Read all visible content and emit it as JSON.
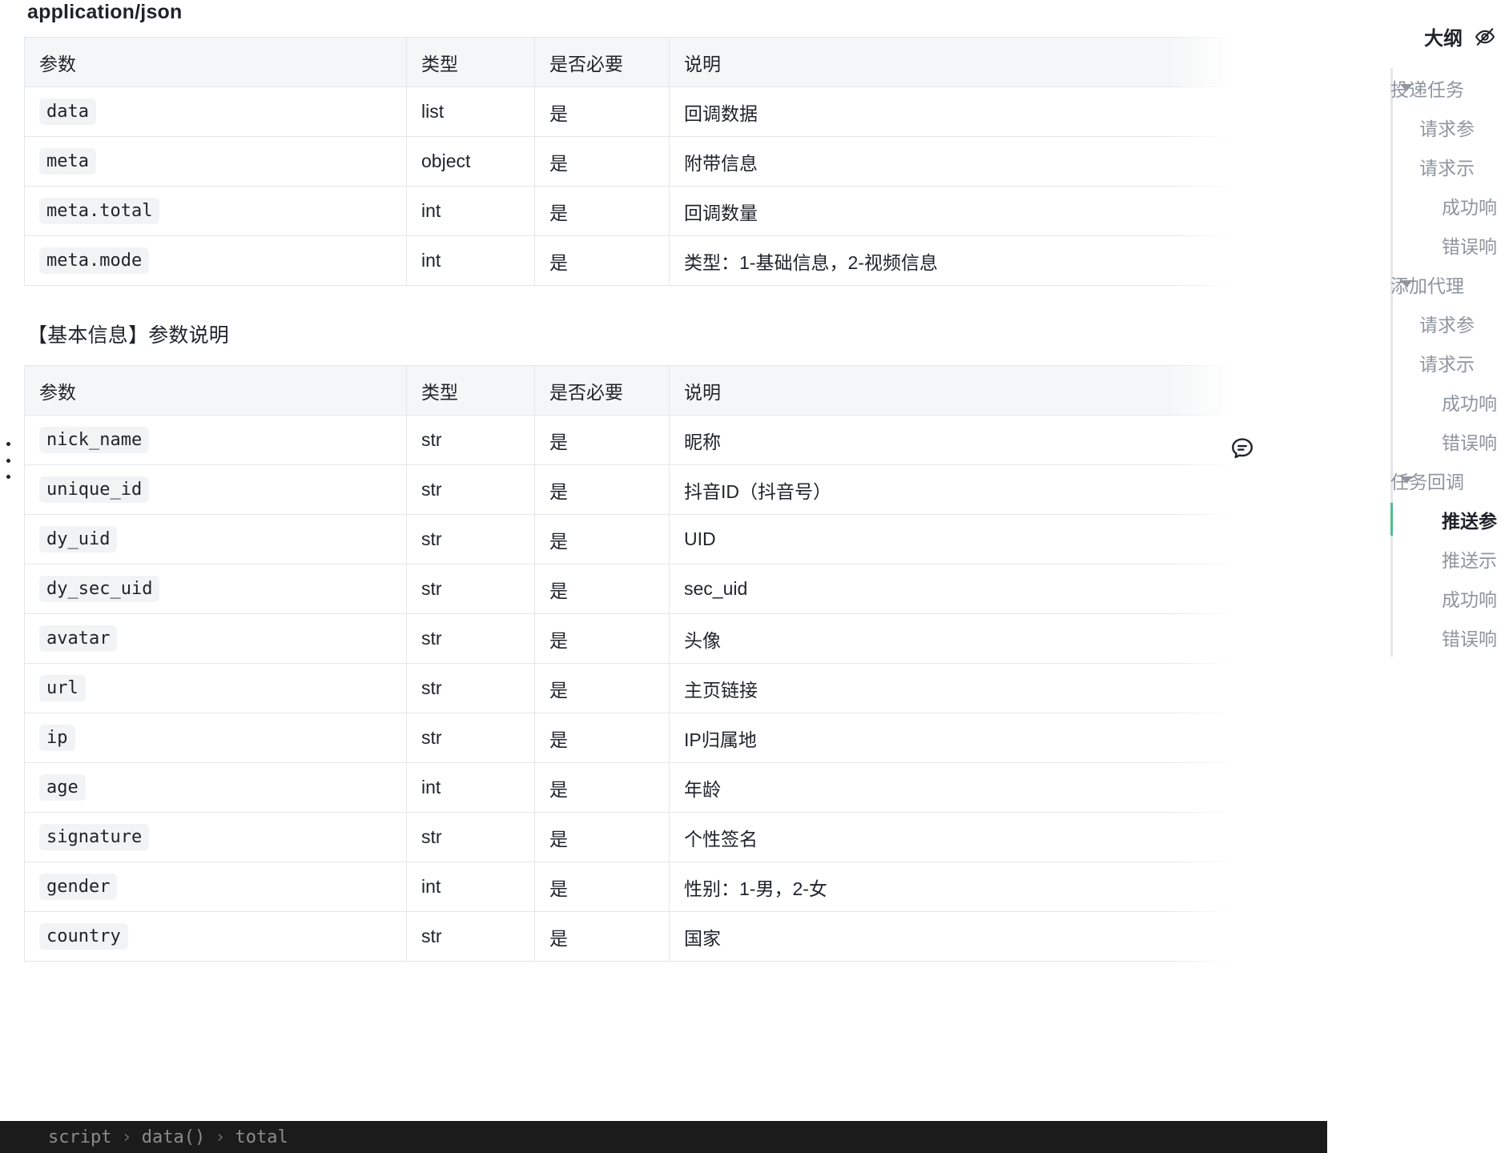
{
  "document": {
    "content_type_heading": "application/json",
    "basic_info_heading": "【基本信息】参数说明"
  },
  "table_columns": [
    "参数",
    "类型",
    "是否必要",
    "说明"
  ],
  "callback_table": {
    "rows": [
      {
        "param": "data",
        "type": "list",
        "required": "是",
        "desc": "回调数据"
      },
      {
        "param": "meta",
        "type": "object",
        "required": "是",
        "desc": "附带信息"
      },
      {
        "param": "meta.total",
        "type": "int",
        "required": "是",
        "desc": "回调数量"
      },
      {
        "param": "meta.mode",
        "type": "int",
        "required": "是",
        "desc": "类型：1-基础信息，2-视频信息"
      }
    ]
  },
  "basic_info_table": {
    "rows": [
      {
        "param": "nick_name",
        "type": "str",
        "required": "是",
        "desc": "昵称"
      },
      {
        "param": "unique_id",
        "type": "str",
        "required": "是",
        "desc": "抖音ID（抖音号）"
      },
      {
        "param": "dy_uid",
        "type": "str",
        "required": "是",
        "desc": "UID"
      },
      {
        "param": "dy_sec_uid",
        "type": "str",
        "required": "是",
        "desc": "sec_uid"
      },
      {
        "param": "avatar",
        "type": "str",
        "required": "是",
        "desc": "头像"
      },
      {
        "param": "url",
        "type": "str",
        "required": "是",
        "desc": "主页链接"
      },
      {
        "param": "ip",
        "type": "str",
        "required": "是",
        "desc": "IP归属地"
      },
      {
        "param": "age",
        "type": "int",
        "required": "是",
        "desc": "年龄"
      },
      {
        "param": "signature",
        "type": "str",
        "required": "是",
        "desc": "个性签名"
      },
      {
        "param": "gender",
        "type": "int",
        "required": "是",
        "desc": "性别：1-男，2-女"
      },
      {
        "param": "country",
        "type": "str",
        "required": "是",
        "desc": "国家"
      }
    ]
  },
  "outline": {
    "title": "大纲",
    "hide_icon": "eye-off-icon",
    "active_color": "#4ebd8d",
    "items": [
      {
        "label": "投递任务",
        "level": 0,
        "expanded": true,
        "active": false
      },
      {
        "label": "请求参",
        "level": 1,
        "expanded": false,
        "active": false
      },
      {
        "label": "请求示",
        "level": 1,
        "expanded": false,
        "active": false
      },
      {
        "label": "成功响",
        "level": 2,
        "expanded": false,
        "active": false
      },
      {
        "label": "错误响",
        "level": 2,
        "expanded": false,
        "active": false
      },
      {
        "label": "添加代理",
        "level": 0,
        "expanded": true,
        "active": false
      },
      {
        "label": "请求参",
        "level": 1,
        "expanded": false,
        "active": false
      },
      {
        "label": "请求示",
        "level": 1,
        "expanded": false,
        "active": false
      },
      {
        "label": "成功响",
        "level": 2,
        "expanded": false,
        "active": false
      },
      {
        "label": "错误响",
        "level": 2,
        "expanded": false,
        "active": false
      },
      {
        "label": "任务回调",
        "level": 0,
        "expanded": true,
        "active": false
      },
      {
        "label": "推送参",
        "level": 2,
        "expanded": false,
        "active": true
      },
      {
        "label": "推送示",
        "level": 2,
        "expanded": false,
        "active": false
      },
      {
        "label": "成功响",
        "level": 2,
        "expanded": false,
        "active": false
      },
      {
        "label": "错误响",
        "level": 2,
        "expanded": false,
        "active": false
      }
    ]
  },
  "comment_button": {
    "icon": "comment-bubble-icon"
  },
  "drag_handle": {
    "icon": "vertical-dots-drag-icon"
  },
  "status_bar": {
    "breadcrumb": [
      "script",
      "data()",
      "total"
    ],
    "separator": "›"
  }
}
